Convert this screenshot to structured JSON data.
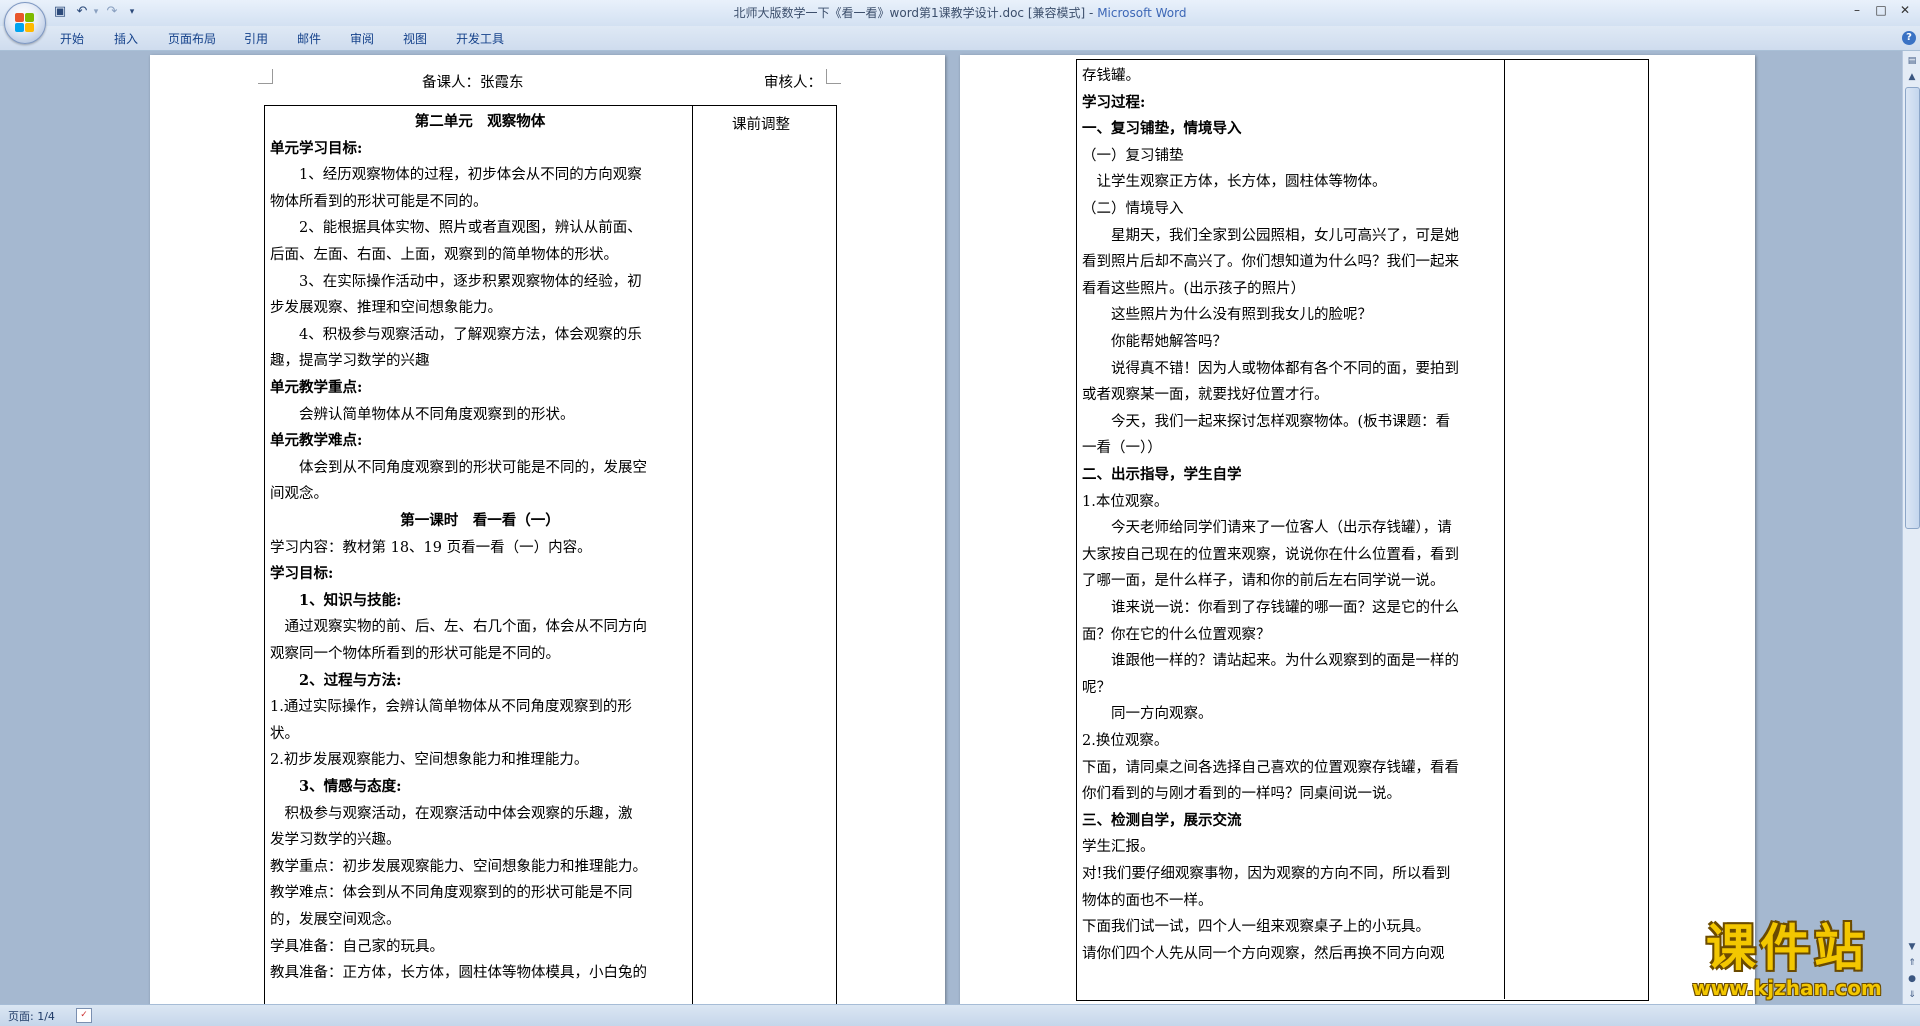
{
  "window": {
    "title_doc": "北师大版数学一下《看一看》word第1课教学设计.doc [兼容模式] - ",
    "title_app": "Microsoft Word",
    "minimize": "–",
    "maximize": "□",
    "close": "✕"
  },
  "qat": {
    "save_icon": "save-icon",
    "undo_icon": "undo-icon",
    "redo_icon": "redo-icon",
    "customize_icon": "dropdown-icon"
  },
  "ribbon": {
    "tabs": [
      "开始",
      "插入",
      "页面布局",
      "引用",
      "邮件",
      "审阅",
      "视图",
      "开发工具"
    ]
  },
  "left_page": {
    "preparer": "备课人：张霞东",
    "reviewer": "审核人：",
    "adjust_header": "课前调整",
    "lines": [
      "第二单元　观察物体",
      "单元学习目标:",
      "1、经历观察物体的过程，初步体会从不同的方向观察",
      "物体所看到的形状可能是不同的。",
      "2、能根据具体实物、照片或者直观图，辨认从前面、",
      "后面、左面、右面、上面，观察到的简单物体的形状。",
      "3、在实际操作活动中，逐步积累观察物体的经验，初",
      "步发展观察、推理和空间想象能力。",
      "4、积极参与观察活动，了解观察方法，体会观察的乐",
      "趣，提高学习数学的兴趣",
      "单元教学重点:",
      "会辨认简单物体从不同角度观察到的形状。",
      "单元教学难点:",
      "体会到从不同角度观察到的形状可能是不同的，发展空",
      "间观念。",
      "第一课时　看一看（一）",
      "学习内容：教材第 18、19 页看一看（一）内容。",
      "学习目标:",
      "1、知识与技能:",
      "通过观察实物的前、后、左、右几个面，体会从不同方向",
      "观察同一个物体所看到的形状可能是不同的。",
      "2、过程与方法:",
      "1.通过实际操作，会辨认简单物体从不同角度观察到的形",
      "状。",
      "2.初步发展观察能力、空间想象能力和推理能力。",
      "3、情感与态度:",
      "积极参与观察活动，在观察活动中体会观察的乐趣，激",
      "发学习数学的兴趣。",
      "教学重点：初步发展观察能力、空间想象能力和推理能力。",
      "教学难点：体会到从不同角度观察到的的形状可能是不同",
      "的，发展空间观念。",
      "学具准备：自己家的玩具。",
      "教具准备：正方体，长方体，圆柱体等物体模具，小白兔的"
    ]
  },
  "right_page": {
    "lines": [
      "存钱罐。",
      "学习过程:",
      "一、复习铺垫，情境导入",
      "（一）复习铺垫",
      "让学生观察正方体，长方体，圆柱体等物体。",
      "（二）情境导入",
      "星期天，我们全家到公园照相，女儿可高兴了，可是她",
      "看到照片后却不高兴了。你们想知道为什么吗？我们一起来",
      "看看这些照片。(出示孩子的照片）",
      "这些照片为什么没有照到我女儿的脸呢？",
      "你能帮她解答吗？",
      "说得真不错！因为人或物体都有各个不同的面，要拍到",
      "或者观察某一面，就要找好位置才行。",
      "今天，我们一起来探讨怎样观察物体。(板书课题：看",
      "一看（一））",
      "二、出示指导，学生自学",
      "1.本位观察。",
      "今天老师给同学们请来了一位客人（出示存钱罐），请",
      "大家按自己现在的位置来观察，说说你在什么位置看，看到",
      "了哪一面，是什么样子，请和你的前后左右同学说一说。",
      "谁来说一说：你看到了存钱罐的哪一面？这是它的什么",
      "面？你在它的什么位置观察？",
      "谁跟他一样的？请站起来。为什么观察到的面是一样的",
      "呢？",
      "同一方向观察。",
      "2.换位观察。",
      "下面，请同桌之间各选择自己喜欢的位置观察存钱罐，看看",
      "你们看到的与刚才看到的一样吗？同桌间说一说。",
      "三、检测自学，展示交流",
      "学生汇报。",
      "对!我们要仔细观察事物，因为观察的方向不同，所以看到",
      "物体的面也不一样。",
      "下面我们试一试，四个人一组来观察桌子上的小玩具。",
      "请你们四个人先从同一个方向观察，然后再换不同方向观"
    ]
  },
  "statusbar": {
    "page_count": "页面: 1/4"
  },
  "watermark": {
    "main": "课件站",
    "url": "www.kjzhan.com"
  },
  "colors": {
    "accent": "#15428b",
    "app_name": "#3c67b6",
    "watermark": "#f3c700"
  }
}
